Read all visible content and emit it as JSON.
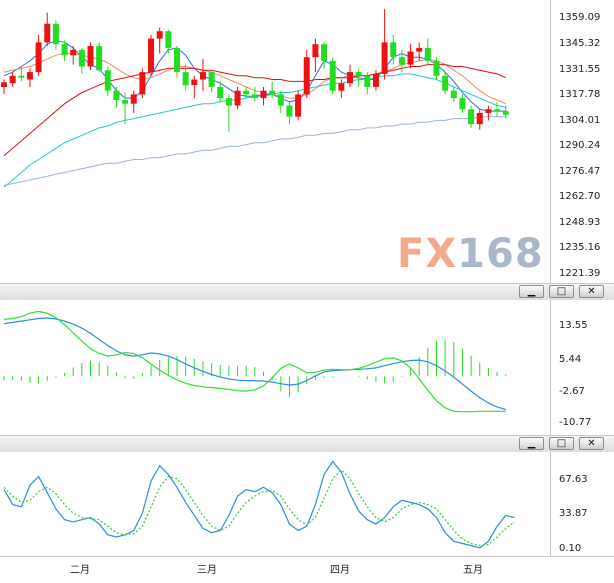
{
  "price_panel": {
    "y_ticks": [
      "1359.09",
      "1345.32",
      "1331.55",
      "1317.78",
      "1304.01",
      "1290.24",
      "1276.47",
      "1262.70",
      "1248.93",
      "1235.16",
      "1221.39"
    ]
  },
  "macd_panel": {
    "y_ticks": [
      "13.55",
      "5.44",
      "-2.67",
      "-10.77"
    ]
  },
  "kdj_panel": {
    "y_ticks": [
      "67.63",
      "33.87",
      "0.10"
    ]
  },
  "x_axis": {
    "months": [
      "二月",
      "三月",
      "四月",
      "五月"
    ]
  },
  "watermark": {
    "brand_fx": "FX",
    "brand_num": "168"
  },
  "window_controls": {
    "minimize": "▁",
    "maximize": "□",
    "close": "✕"
  },
  "colors": {
    "up": "#ee1111",
    "down": "#22dd22",
    "ma_fast": "#2a6fe0",
    "ma_mid": "#f08a5a",
    "ma_slow": "#dd1111",
    "ma_cyan": "#22c9c9",
    "ma_long": "#9ab3d6"
  },
  "chart_data": [
    {
      "type": "candlestick",
      "ylim": [
        1221.39,
        1359.09
      ],
      "candles": [
        [
          1322.0,
          1326.0,
          1318.0,
          1324.5
        ],
        [
          1324.0,
          1330.0,
          1322.0,
          1328.0
        ],
        [
          1328.0,
          1333.0,
          1325.0,
          1327.0
        ],
        [
          1326.0,
          1332.0,
          1322.0,
          1330.0
        ],
        [
          1330.0,
          1350.0,
          1328.0,
          1346.0
        ],
        [
          1346.0,
          1362.0,
          1344.0,
          1356.0
        ],
        [
          1356.0,
          1358.0,
          1342.0,
          1345.0
        ],
        [
          1345.0,
          1347.0,
          1336.0,
          1339.0
        ],
        [
          1339.0,
          1344.0,
          1334.0,
          1342.0
        ],
        [
          1342.0,
          1343.0,
          1329.0,
          1333.0
        ],
        [
          1333.0,
          1346.0,
          1331.0,
          1344.0
        ],
        [
          1344.0,
          1346.0,
          1330.0,
          1331.0
        ],
        [
          1331.0,
          1333.0,
          1317.0,
          1320.0
        ],
        [
          1320.0,
          1322.0,
          1311.0,
          1315.0
        ],
        [
          1315.0,
          1319.0,
          1302.0,
          1313.0
        ],
        [
          1313.0,
          1320.0,
          1308.0,
          1318.0
        ],
        [
          1318.0,
          1332.0,
          1316.0,
          1330.0
        ],
        [
          1330.0,
          1350.0,
          1328.0,
          1348.0
        ],
        [
          1348.0,
          1354.0,
          1340.0,
          1352.0
        ],
        [
          1352.0,
          1353.0,
          1340.0,
          1343.0
        ],
        [
          1343.0,
          1344.0,
          1327.0,
          1330.0
        ],
        [
          1330.0,
          1334.0,
          1320.0,
          1323.0
        ],
        [
          1323.0,
          1328.0,
          1316.0,
          1326.0
        ],
        [
          1326.0,
          1337.0,
          1320.0,
          1330.0
        ],
        [
          1330.0,
          1331.0,
          1319.0,
          1322.0
        ],
        [
          1322.0,
          1325.0,
          1314.0,
          1316.0
        ],
        [
          1316.0,
          1318.0,
          1298.0,
          1312.0
        ],
        [
          1312.0,
          1322.0,
          1310.0,
          1320.0
        ],
        [
          1320.0,
          1322.0,
          1316.0,
          1318.0
        ],
        [
          1318.0,
          1322.0,
          1314.0,
          1316.0
        ],
        [
          1316.0,
          1322.0,
          1312.0,
          1320.0
        ],
        [
          1320.0,
          1325.0,
          1316.0,
          1318.0
        ],
        [
          1318.0,
          1320.0,
          1308.0,
          1312.0
        ],
        [
          1312.0,
          1314.0,
          1302.0,
          1306.0
        ],
        [
          1306.0,
          1320.0,
          1304.0,
          1318.0
        ],
        [
          1318.0,
          1342.0,
          1316.0,
          1338.0
        ],
        [
          1338.0,
          1348.0,
          1330.0,
          1345.0
        ],
        [
          1345.0,
          1346.0,
          1332.0,
          1336.0
        ],
        [
          1336.0,
          1338.0,
          1318.0,
          1320.0
        ],
        [
          1320.0,
          1326.0,
          1316.0,
          1324.0
        ],
        [
          1324.0,
          1334.0,
          1322.0,
          1330.0
        ],
        [
          1330.0,
          1332.0,
          1322.0,
          1328.0
        ],
        [
          1328.0,
          1330.0,
          1318.0,
          1322.0
        ],
        [
          1322.0,
          1331.0,
          1320.0,
          1329.0
        ],
        [
          1329.0,
          1364.0,
          1326.0,
          1346.0
        ],
        [
          1346.0,
          1350.0,
          1334.0,
          1338.0
        ],
        [
          1338.0,
          1342.0,
          1330.0,
          1334.0
        ],
        [
          1334.0,
          1345.0,
          1332.0,
          1341.0
        ],
        [
          1341.0,
          1346.0,
          1336.0,
          1343.0
        ],
        [
          1343.0,
          1348.0,
          1334.0,
          1336.0
        ],
        [
          1336.0,
          1338.0,
          1326.0,
          1328.0
        ],
        [
          1328.0,
          1330.0,
          1318.0,
          1320.0
        ],
        [
          1320.0,
          1322.0,
          1314.0,
          1316.0
        ],
        [
          1316.0,
          1318.0,
          1308.0,
          1310.0
        ],
        [
          1310.0,
          1312.0,
          1300.0,
          1302.0
        ],
        [
          1302.0,
          1310.0,
          1299.0,
          1308.0
        ],
        [
          1308.0,
          1312.0,
          1304.0,
          1310.0
        ],
        [
          1310.0,
          1314.0,
          1306.0,
          1309.0
        ],
        [
          1309.0,
          1312.0,
          1305.0,
          1307.0
        ]
      ],
      "series": [
        {
          "values": [
            1328,
            1330,
            1333,
            1336,
            1340,
            1345,
            1347,
            1346,
            1343,
            1338,
            1334,
            1332,
            1326,
            1320,
            1316,
            1316,
            1320,
            1328,
            1336,
            1342,
            1343,
            1339,
            1332,
            1328,
            1326,
            1324,
            1321,
            1318,
            1317,
            1317,
            1318,
            1318,
            1316,
            1314,
            1315,
            1320,
            1328,
            1336,
            1334,
            1330,
            1328,
            1327,
            1326,
            1326,
            1332,
            1338,
            1340,
            1338,
            1338,
            1337,
            1334,
            1330,
            1325,
            1319,
            1314,
            1310,
            1309,
            1309,
            1309
          ]
        },
        {
          "values": [
            1330,
            1331,
            1332,
            1333,
            1335,
            1337,
            1339,
            1340,
            1340,
            1339,
            1338,
            1337,
            1335,
            1332,
            1329,
            1327,
            1326,
            1327,
            1329,
            1331,
            1333,
            1333,
            1332,
            1331,
            1330,
            1328,
            1326,
            1324,
            1322,
            1320,
            1319,
            1318,
            1317,
            1316,
            1316,
            1318,
            1321,
            1325,
            1327,
            1327,
            1328,
            1328,
            1328,
            1329,
            1330,
            1332,
            1334,
            1335,
            1336,
            1337,
            1336,
            1334,
            1331,
            1328,
            1324,
            1320,
            1317,
            1315,
            1313
          ]
        },
        {
          "values": [
            1285,
            1289,
            1293,
            1297,
            1301,
            1305,
            1309,
            1313,
            1316,
            1319,
            1321,
            1323,
            1325,
            1326,
            1327,
            1328,
            1329,
            1330,
            1331,
            1332,
            1332,
            1332,
            1332,
            1331,
            1331,
            1330,
            1329,
            1328,
            1328,
            1327,
            1327,
            1326,
            1326,
            1325,
            1325,
            1325,
            1326,
            1326,
            1327,
            1327,
            1327,
            1328,
            1328,
            1329,
            1330,
            1331,
            1332,
            1333,
            1333,
            1334,
            1334,
            1334,
            1333,
            1333,
            1332,
            1331,
            1330,
            1329,
            1327
          ]
        },
        {
          "values": [
            1268,
            1272,
            1276,
            1280,
            1283,
            1286,
            1289,
            1292,
            1294,
            1296,
            1298,
            1300,
            1301,
            1303,
            1304,
            1305,
            1306,
            1307,
            1308,
            1309,
            1310,
            1311,
            1312,
            1313,
            1313,
            1314,
            1315,
            1315,
            1316,
            1317,
            1317,
            1318,
            1319,
            1319,
            1320,
            1321,
            1322,
            1323,
            1324,
            1324,
            1325,
            1326,
            1326,
            1327,
            1328,
            1328,
            1329,
            1329,
            1328,
            1327,
            1326,
            1324,
            1322,
            1320,
            1318,
            1316,
            1314,
            1312,
            1311
          ]
        },
        {
          "values": [
            1269,
            1270,
            1271,
            1272,
            1273,
            1274,
            1275,
            1276,
            1277,
            1278,
            1279,
            1280,
            1281,
            1281,
            1282,
            1283,
            1283,
            1284,
            1284,
            1285,
            1286,
            1286,
            1287,
            1288,
            1288,
            1289,
            1290,
            1290,
            1291,
            1292,
            1292,
            1293,
            1294,
            1294,
            1295,
            1296,
            1296,
            1297,
            1297,
            1298,
            1299,
            1299,
            1300,
            1300,
            1301,
            1301,
            1302,
            1302,
            1303,
            1303,
            1304,
            1304,
            1305,
            1305,
            1305,
            1306,
            1306,
            1306,
            1306
          ]
        }
      ]
    },
    {
      "type": "line",
      "ylim": [
        -12.5,
        16.5
      ],
      "series": [
        {
          "values": [
            12.0,
            12.3,
            12.6,
            12.9,
            13.2,
            13.3,
            13.1,
            12.6,
            11.9,
            11.0,
            9.8,
            8.4,
            7.0,
            5.8,
            4.9,
            4.6,
            4.9,
            5.3,
            5.1,
            4.6,
            3.8,
            2.8,
            1.9,
            1.1,
            0.4,
            -0.2,
            -0.6,
            -0.9,
            -1.0,
            -1.0,
            -1.1,
            -1.3,
            -1.7,
            -2.0,
            -1.8,
            -1.0,
            0.1,
            1.0,
            1.3,
            1.4,
            1.5,
            1.6,
            1.7,
            1.9,
            2.4,
            2.9,
            3.3,
            3.6,
            3.7,
            3.3,
            2.4,
            1.2,
            -0.2,
            -1.8,
            -3.4,
            -4.9,
            -6.1,
            -7.0,
            -7.6
          ]
        },
        {
          "values": [
            13.0,
            13.2,
            13.6,
            14.4,
            14.8,
            14.4,
            13.4,
            11.8,
            9.9,
            8.0,
            6.3,
            5.2,
            4.6,
            4.9,
            5.4,
            5.2,
            4.2,
            2.8,
            1.4,
            0.2,
            -0.8,
            -1.6,
            -2.1,
            -2.4,
            -2.6,
            -2.8,
            -3.0,
            -3.3,
            -3.4,
            -3.1,
            -2.2,
            -0.4,
            1.8,
            2.8,
            1.9,
            0.8,
            0.9,
            1.4,
            1.6,
            1.5,
            1.5,
            1.8,
            2.4,
            3.2,
            4.0,
            4.2,
            3.5,
            1.9,
            -0.6,
            -3.2,
            -5.6,
            -7.2,
            -8.0,
            -8.1,
            -8.1,
            -8.0,
            -8.0,
            -8.0,
            -8.0
          ]
        }
      ]
    },
    {
      "type": "line",
      "ylim": [
        0.1,
        89.0
      ],
      "series": [
        {
          "values": [
            58,
            44,
            42,
            62,
            70,
            55,
            40,
            30,
            28,
            30,
            32,
            26,
            16,
            14,
            16,
            20,
            36,
            66,
            80,
            72,
            60,
            46,
            34,
            22,
            18,
            20,
            34,
            52,
            58,
            56,
            60,
            55,
            44,
            26,
            20,
            24,
            44,
            72,
            84,
            74,
            54,
            38,
            30,
            26,
            32,
            42,
            48,
            46,
            44,
            40,
            32,
            18,
            10,
            8,
            6,
            4,
            10,
            24,
            34,
            32
          ]
        },
        {
          "values": [
            60,
            52,
            46,
            48,
            56,
            60,
            54,
            44,
            36,
            32,
            31,
            30,
            24,
            18,
            16,
            17,
            24,
            42,
            60,
            70,
            68,
            58,
            46,
            34,
            24,
            20,
            24,
            36,
            46,
            52,
            56,
            57,
            52,
            40,
            30,
            25,
            32,
            50,
            68,
            76,
            68,
            54,
            42,
            32,
            28,
            32,
            40,
            44,
            46,
            44,
            40,
            30,
            20,
            12,
            8,
            6,
            7,
            14,
            22,
            28
          ]
        }
      ]
    }
  ]
}
